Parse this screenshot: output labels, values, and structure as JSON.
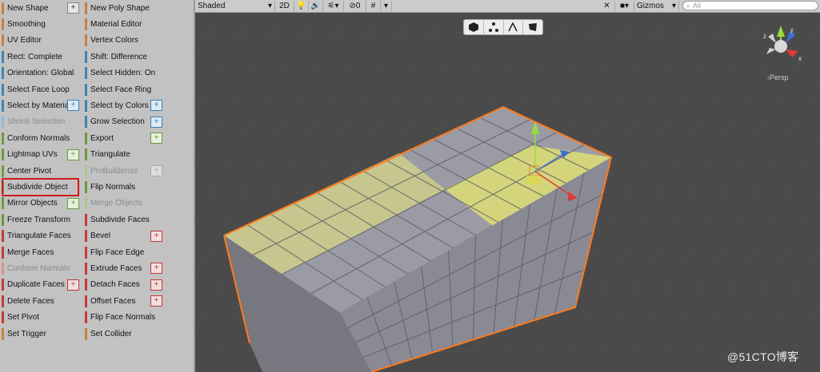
{
  "panel": {
    "left_items": [
      {
        "label": "New Shape",
        "color": "#c9823a",
        "plus": "normal"
      },
      {
        "label": "Smoothing",
        "color": "#c9823a",
        "plus": ""
      },
      {
        "label": "UV Editor",
        "color": "#c9823a",
        "plus": ""
      },
      {
        "label": "Rect: Complete",
        "color": "#3a86b8",
        "plus": ""
      },
      {
        "label": "Orientation: Global",
        "color": "#3a86b8",
        "plus": ""
      },
      {
        "label": "Select Face Loop",
        "color": "#3a86b8",
        "plus": ""
      },
      {
        "label": "Select by Material",
        "color": "#3a86b8",
        "plus": "blue"
      },
      {
        "label": "Shrink Selection",
        "color": "#8fb9d8",
        "plus": "",
        "disabled": true
      },
      {
        "label": "Conform Normals",
        "color": "#6a9a3a",
        "plus": ""
      },
      {
        "label": "Lightmap UVs",
        "color": "#6a9a3a",
        "plus": "green"
      },
      {
        "label": "Center Pivot",
        "color": "#6a9a3a",
        "plus": ""
      },
      {
        "label": "Subdivide Object",
        "color": "#6a9a3a",
        "plus": ""
      },
      {
        "label": "Mirror Objects",
        "color": "#6a9a3a",
        "plus": "green"
      },
      {
        "label": "Freeze Transform",
        "color": "#6a9a3a",
        "plus": ""
      },
      {
        "label": "Triangulate Faces",
        "color": "#c23a3a",
        "plus": ""
      },
      {
        "label": "Merge Faces",
        "color": "#c23a3a",
        "plus": ""
      },
      {
        "label": "Conform Normals",
        "color": "#d89090",
        "plus": "",
        "disabled": true
      },
      {
        "label": "Duplicate Faces",
        "color": "#c23a3a",
        "plus": "red"
      },
      {
        "label": "Delete Faces",
        "color": "#c23a3a",
        "plus": ""
      },
      {
        "label": "Set Pivot",
        "color": "#c23a3a",
        "plus": ""
      },
      {
        "label": "Set Trigger",
        "color": "#c9823a",
        "plus": ""
      }
    ],
    "right_items": [
      {
        "label": "New Poly Shape",
        "color": "#c9823a",
        "plus": ""
      },
      {
        "label": "Material Editor",
        "color": "#c9823a",
        "plus": ""
      },
      {
        "label": "Vertex Colors",
        "color": "#c9823a",
        "plus": ""
      },
      {
        "label": "Shift: Difference",
        "color": "#3a86b8",
        "plus": ""
      },
      {
        "label": "Select Hidden: On",
        "color": "#3a86b8",
        "plus": ""
      },
      {
        "label": "Select Face Ring",
        "color": "#3a86b8",
        "plus": ""
      },
      {
        "label": "Select by Colors",
        "color": "#3a86b8",
        "plus": "blue"
      },
      {
        "label": "Grow Selection",
        "color": "#3a86b8",
        "plus": "blue"
      },
      {
        "label": "Export",
        "color": "#6a9a3a",
        "plus": "green"
      },
      {
        "label": "Triangulate",
        "color": "#6a9a3a",
        "plus": ""
      },
      {
        "label": "ProBuilderize",
        "color": "#a8c890",
        "plus": "gray",
        "disabled": true
      },
      {
        "label": "Flip Normals",
        "color": "#6a9a3a",
        "plus": ""
      },
      {
        "label": "Merge Objects",
        "color": "#a8c890",
        "plus": "",
        "disabled": true
      },
      {
        "label": "Subdivide Faces",
        "color": "#c23a3a",
        "plus": ""
      },
      {
        "label": "Bevel",
        "color": "#c23a3a",
        "plus": "red"
      },
      {
        "label": "Flip Face Edge",
        "color": "#c23a3a",
        "plus": ""
      },
      {
        "label": "Extrude Faces",
        "color": "#c23a3a",
        "plus": "red"
      },
      {
        "label": "Detach Faces",
        "color": "#c23a3a",
        "plus": "red"
      },
      {
        "label": "Offset Faces",
        "color": "#c23a3a",
        "plus": "red"
      },
      {
        "label": "Flip Face Normals",
        "color": "#c23a3a",
        "plus": ""
      },
      {
        "label": "Set Collider",
        "color": "#c9823a",
        "plus": ""
      }
    ],
    "plus_glyph": "+"
  },
  "toolbar": {
    "shading": "Shaded",
    "mode_2d": "2D",
    "hidden_count": "0",
    "gizmos": "Gizmos",
    "search_placeholder": "All"
  },
  "scene": {
    "persp_label": "‹Persp",
    "watermark": "@51CTO博客"
  }
}
